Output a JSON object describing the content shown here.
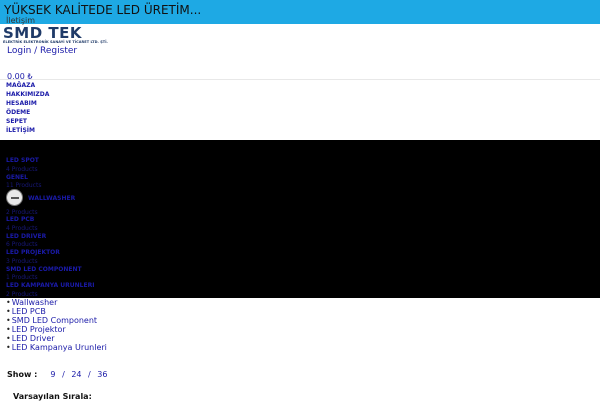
{
  "topbar": {
    "slogan": "YÜKSEK KALİTEDE LED ÜRETİM..."
  },
  "header": {
    "contact_link": "İletişim",
    "logo_text": "SMD TEK",
    "logo_subtitle": "ELEKTRİK ELEKTRONİK SANAYİ VE TİCARET LTD. ŞTİ.",
    "login_link": "Login / Register",
    "cart_total": "0,00 ₺"
  },
  "nav": {
    "items": [
      {
        "label": "MAĞAZA"
      },
      {
        "label": "HAKKIMIZDA"
      },
      {
        "label": "HESABIM"
      },
      {
        "label": "ÖDEME"
      },
      {
        "label": "SEPET"
      },
      {
        "label": "İLETİŞİM"
      }
    ]
  },
  "categories": [
    {
      "name": "LED SPOT",
      "count": "4 Products"
    },
    {
      "name": "GENEL",
      "count": "11 Products"
    },
    {
      "name": "WALLWASHER",
      "count": "2 Products",
      "icon": "wallwasher-thumbnail-icon"
    },
    {
      "name": "LED PCB",
      "count": "4 Products"
    },
    {
      "name": "LED DRIVER",
      "count": "6 Products"
    },
    {
      "name": "LED PROJEKTOR",
      "count": "3 Products"
    },
    {
      "name": "SMD LED COMPONENT",
      "count": "1 Products"
    },
    {
      "name": "LED KAMPANYA URUNLERI",
      "count": "2 Products"
    }
  ],
  "subcategories": [
    {
      "label": "Wallwasher"
    },
    {
      "label": "LED PCB"
    },
    {
      "label": "SMD LED Component"
    },
    {
      "label": "LED Projektor"
    },
    {
      "label": "LED Driver"
    },
    {
      "label": "LED Kampanya Urunleri"
    }
  ],
  "toolbar": {
    "show_label": "Show :",
    "show_options": [
      "9",
      "24",
      "36"
    ],
    "separator": "/",
    "sort_label": "Varsayılan Sırala:"
  },
  "colors": {
    "topbar_bg": "#1ea9e4",
    "link": "#1a1aa8",
    "panel_bg": "#000000"
  }
}
